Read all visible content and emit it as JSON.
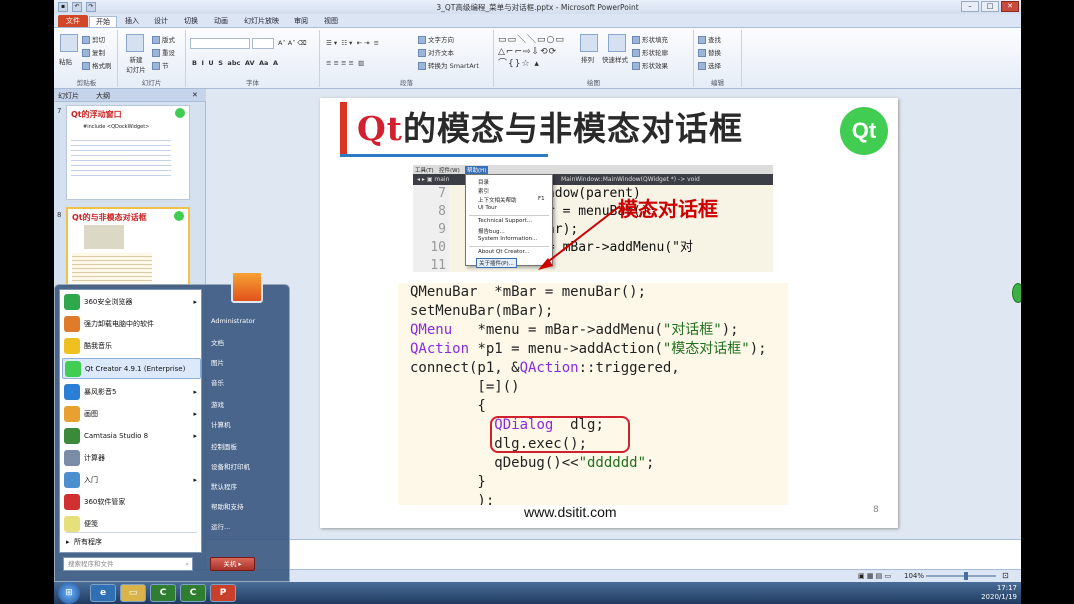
{
  "window": {
    "title": "3_QT高级编程_菜单与对话框.pptx - Microsoft PowerPoint"
  },
  "tabs": [
    "文件",
    "开始",
    "插入",
    "设计",
    "切换",
    "动画",
    "幻灯片放映",
    "审阅",
    "视图"
  ],
  "ribbon": {
    "clipboard": {
      "paste": "粘贴",
      "cut": "剪切",
      "copy": "复制",
      "format_painter": "格式刷",
      "label": "剪贴板"
    },
    "slides": {
      "new_slide": "新建\n幻灯片",
      "layout": "版式",
      "reset": "重设",
      "section": "节",
      "label": "幻灯片"
    },
    "font": {
      "label": "字体"
    },
    "paragraph": {
      "text_direction": "文字方向",
      "align_text": "对齐文本",
      "smartart": "转换为 SmartArt",
      "label": "段落"
    },
    "drawing": {
      "arrange": "排列",
      "quick_styles": "快速样式",
      "shape_fill": "形状填充",
      "shape_outline": "形状轮廓",
      "shape_effects": "形状效果",
      "label": "绘图"
    },
    "editing": {
      "find": "查找",
      "replace": "替换",
      "select": "选择",
      "label": "编辑"
    }
  },
  "slide_panel": {
    "tabs": [
      "幻灯片",
      "大纲"
    ],
    "thumb7": {
      "num": "7",
      "title": "Qt的浮动窗口",
      "code_head": "#include <QDockWidget>"
    },
    "thumb8": {
      "num": "8",
      "title": "Qt的与非模态对话框"
    }
  },
  "slide": {
    "title_q": "Qt",
    "title_rest": "的模态与非模态对话框",
    "logo": "Qt",
    "screenshot": {
      "menubar": [
        "工具(T)",
        "控件(W)",
        "帮助(H)"
      ],
      "path_text": "MainWindow::MainWindow(QWidget *) -> void",
      "line_numbers": [
        "7",
        "8",
        "9",
        "10",
        "11"
      ],
      "code_lines": [
        "        inWindow(parent)",
        "",
        "    ar  *mBar = menuBar();",
        "      Bar(mBar);",
        "      *menu = mBar->addMenu(\"对"
      ],
      "context_menu": [
        "目录",
        "索引",
        "上下文相关帮助",
        "UI Tour",
        "Technical Support...",
        "报告bug...",
        "System Information...",
        "About Qt Creator...",
        "关于插件(P)..."
      ],
      "context_shortcut": "F1"
    },
    "annotation": "模态对话框",
    "code": {
      "l1": "QMenuBar  *mBar = menuBar();",
      "l2": "setMenuBar(mBar);",
      "l3a": "QMenu   ",
      "l3b": "*menu = mBar->addMenu(",
      "l3c": "\"对话框\"",
      "l3d": ");",
      "l4a": "QAction ",
      "l4b": "*p1 = menu->addAction(",
      "l4c": "\"模态对话框\"",
      "l4d": ");",
      "l5a": "connect(p1, &",
      "l5b": "QAction",
      "l5c": "::triggered,",
      "l6": "        [=]()",
      "l7": "        {",
      "l8a": "          ",
      "l8b": "QDialog",
      "l8c": "  dlg;",
      "l9": "          dlg.exec();",
      "l10a": "          qDebug()<<",
      "l10b": "\"dddddd\"",
      "l10c": ";",
      "l11": "        }",
      "l12": "        );"
    },
    "url": "www.dsitit.com",
    "page_number": "8"
  },
  "start_menu": {
    "items": [
      {
        "label": "360安全浏览器",
        "arrow": true,
        "color": "#2ea84a"
      },
      {
        "label": "强力卸载电脑中的软件",
        "arrow": false,
        "color": "#e07b2a"
      },
      {
        "label": "酷我音乐",
        "arrow": false,
        "color": "#f0c020"
      },
      {
        "label": "Qt Creator 4.9.1 (Enterprise)",
        "arrow": false,
        "color": "#41cd52"
      },
      {
        "label": "暴风影音5",
        "arrow": true,
        "color": "#2a7fd4"
      },
      {
        "label": "画图",
        "arrow": true,
        "color": "#e8a030"
      },
      {
        "label": "Camtasia Studio 8",
        "arrow": true,
        "color": "#3a8a3a"
      },
      {
        "label": "计算器",
        "arrow": false,
        "color": "#7a8ca6"
      },
      {
        "label": "入门",
        "arrow": true,
        "color": "#4a90d0"
      },
      {
        "label": "360软件管家",
        "arrow": false,
        "color": "#d03030"
      },
      {
        "label": "便笺",
        "arrow": false,
        "color": "#e6e07a"
      }
    ],
    "all_programs": "所有程序",
    "search_placeholder": "搜索程序和文件",
    "right": [
      "Administrator",
      "文档",
      "图片",
      "音乐",
      "游戏",
      "计算机",
      "控制面板",
      "设备和打印机",
      "默认程序",
      "帮助和支持",
      "运行..."
    ],
    "shutdown": "关机"
  },
  "status": {
    "zoom": "104%"
  },
  "clock": {
    "time": "17:17",
    "date": "2020/1/19"
  }
}
